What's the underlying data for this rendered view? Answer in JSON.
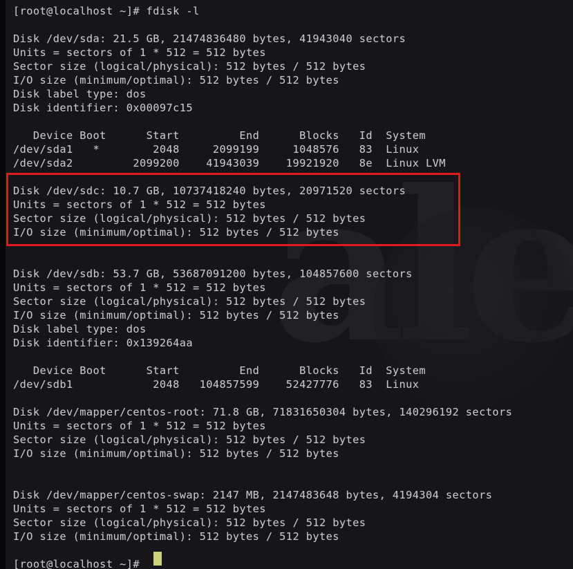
{
  "terminal": {
    "prompt": "[root@localhost ~]#",
    "command": "fdisk -l",
    "colors": {
      "background": "#16161a",
      "text": "#c9c9c9",
      "highlight_border": "#e01b1b",
      "cursor": "#ccd27a",
      "watermark": "#2a2a2e"
    },
    "watermark_text": "ale",
    "command_line": "[root@localhost ~]# fdisk -l",
    "final_prompt": "[root@localhost ~]# ",
    "screen_text": "[root@localhost ~]# fdisk -l\n\nDisk /dev/sda: 21.5 GB, 21474836480 bytes, 41943040 sectors\nUnits = sectors of 1 * 512 = 512 bytes\nSector size (logical/physical): 512 bytes / 512 bytes\nI/O size (minimum/optimal): 512 bytes / 512 bytes\nDisk label type: dos\nDisk identifier: 0x00097c15\n\n   Device Boot      Start         End      Blocks   Id  System\n/dev/sda1   *        2048     2099199     1048576   83  Linux\n/dev/sda2         2099200    41943039    19921920   8e  Linux LVM\n\nDisk /dev/sdc: 10.7 GB, 10737418240 bytes, 20971520 sectors\nUnits = sectors of 1 * 512 = 512 bytes\nSector size (logical/physical): 512 bytes / 512 bytes\nI/O size (minimum/optimal): 512 bytes / 512 bytes\n\n\nDisk /dev/sdb: 53.7 GB, 53687091200 bytes, 104857600 sectors\nUnits = sectors of 1 * 512 = 512 bytes\nSector size (logical/physical): 512 bytes / 512 bytes\nI/O size (minimum/optimal): 512 bytes / 512 bytes\nDisk label type: dos\nDisk identifier: 0x139264aa\n\n   Device Boot      Start         End      Blocks   Id  System\n/dev/sdb1            2048   104857599    52427776   83  Linux\n\nDisk /dev/mapper/centos-root: 71.8 GB, 71831650304 bytes, 140296192 sectors\nUnits = sectors of 1 * 512 = 512 bytes\nSector size (logical/physical): 512 bytes / 512 bytes\nI/O size (minimum/optimal): 512 bytes / 512 bytes\n\n\nDisk /dev/mapper/centos-swap: 2147 MB, 2147483648 bytes, 4194304 sectors\nUnits = sectors of 1 * 512 = 512 bytes\nSector size (logical/physical): 512 bytes / 512 bytes\nI/O size (minimum/optimal): 512 bytes / 512 bytes\n\n[root@localhost ~]# "
  },
  "disks": [
    {
      "name": "/dev/sda",
      "size_human": "21.5 GB",
      "size_bytes": "21474836480 bytes",
      "sectors": "41943040 sectors",
      "units": "Units = sectors of 1 * 512 = 512 bytes",
      "sector_size": "Sector size (logical/physical): 512 bytes / 512 bytes",
      "io_size": "I/O size (minimum/optimal): 512 bytes / 512 bytes",
      "label_type": "Disk label type: dos",
      "identifier": "Disk identifier: 0x00097c15",
      "highlighted": false,
      "partition_table": {
        "headers": [
          "Device",
          "Boot",
          "Start",
          "End",
          "Blocks",
          "Id",
          "System"
        ],
        "rows": [
          {
            "device": "/dev/sda1",
            "boot": "*",
            "start": "2048",
            "end": "2099199",
            "blocks": "1048576",
            "id": "83",
            "system": "Linux"
          },
          {
            "device": "/dev/sda2",
            "boot": "",
            "start": "2099200",
            "end": "41943039",
            "blocks": "19921920",
            "id": "8e",
            "system": "Linux LVM"
          }
        ]
      }
    },
    {
      "name": "/dev/sdc",
      "size_human": "10.7 GB",
      "size_bytes": "10737418240 bytes",
      "sectors": "20971520 sectors",
      "units": "Units = sectors of 1 * 512 = 512 bytes",
      "sector_size": "Sector size (logical/physical): 512 bytes / 512 bytes",
      "io_size": "I/O size (minimum/optimal): 512 bytes / 512 bytes",
      "label_type": "",
      "identifier": "",
      "highlighted": true,
      "partition_table": null
    },
    {
      "name": "/dev/sdb",
      "size_human": "53.7 GB",
      "size_bytes": "53687091200 bytes",
      "sectors": "104857600 sectors",
      "units": "Units = sectors of 1 * 512 = 512 bytes",
      "sector_size": "Sector size (logical/physical): 512 bytes / 512 bytes",
      "io_size": "I/O size (minimum/optimal): 512 bytes / 512 bytes",
      "label_type": "Disk label type: dos",
      "identifier": "Disk identifier: 0x139264aa",
      "highlighted": false,
      "partition_table": {
        "headers": [
          "Device",
          "Boot",
          "Start",
          "End",
          "Blocks",
          "Id",
          "System"
        ],
        "rows": [
          {
            "device": "/dev/sdb1",
            "boot": "",
            "start": "2048",
            "end": "104857599",
            "blocks": "52427776",
            "id": "83",
            "system": "Linux"
          }
        ]
      }
    },
    {
      "name": "/dev/mapper/centos-root",
      "size_human": "71.8 GB",
      "size_bytes": "71831650304 bytes",
      "sectors": "140296192 sectors",
      "units": "Units = sectors of 1 * 512 = 512 bytes",
      "sector_size": "Sector size (logical/physical): 512 bytes / 512 bytes",
      "io_size": "I/O size (minimum/optimal): 512 bytes / 512 bytes",
      "label_type": "",
      "identifier": "",
      "highlighted": false,
      "partition_table": null
    },
    {
      "name": "/dev/mapper/centos-swap",
      "size_human": "2147 MB",
      "size_bytes": "2147483648 bytes",
      "sectors": "4194304 sectors",
      "units": "Units = sectors of 1 * 512 = 512 bytes",
      "sector_size": "Sector size (logical/physical): 512 bytes / 512 bytes",
      "io_size": "I/O size (minimum/optimal): 512 bytes / 512 bytes",
      "label_type": "",
      "identifier": "",
      "highlighted": false,
      "partition_table": null
    }
  ]
}
